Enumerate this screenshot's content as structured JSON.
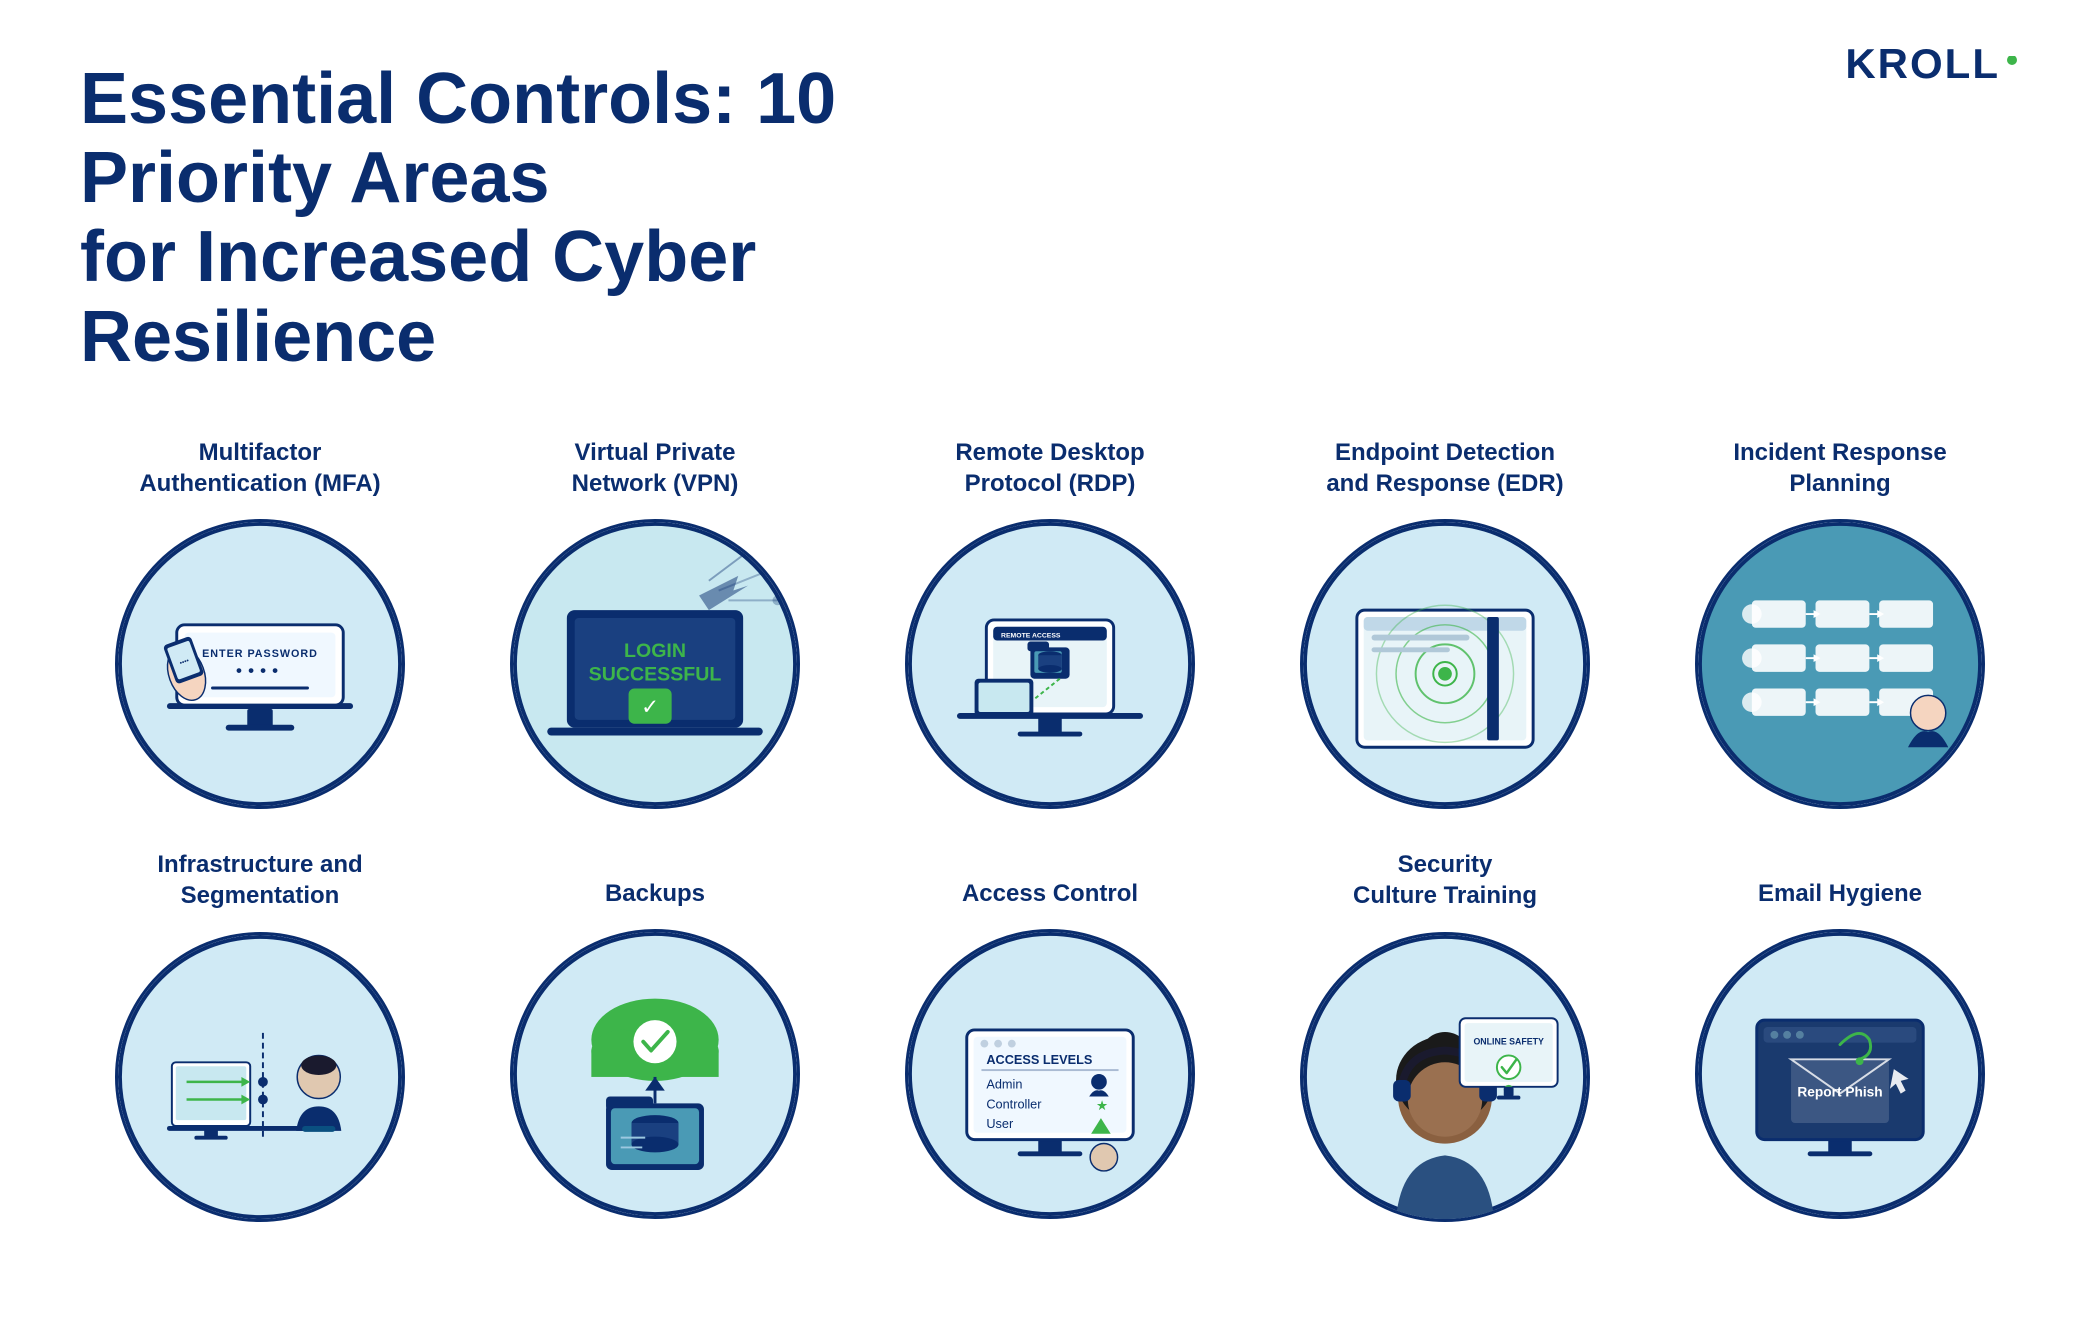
{
  "logo": {
    "text": "KROLL",
    "dot_color": "#3db54a"
  },
  "title": {
    "line1": "Essential Controls: 10 Priority Areas",
    "line2": "for Increased Cyber Resilience"
  },
  "row1": [
    {
      "id": "mfa",
      "title": "Multifactor\nAuthentication (MFA)",
      "title_display": "Multifactor Authentication (MFA)"
    },
    {
      "id": "vpn",
      "title": "Virtual Private\nNetwork (VPN)",
      "title_display": "Virtual Private Network (VPN)"
    },
    {
      "id": "rdp",
      "title": "Remote Desktop\nProtocol (RDP)",
      "title_display": "Remote Desktop Protocol (RDP)"
    },
    {
      "id": "edr",
      "title": "Endpoint Detection\nand Response (EDR)",
      "title_display": "Endpoint Detection and Response (EDR)"
    },
    {
      "id": "irp",
      "title": "Incident Response\nPlanning",
      "title_display": "Incident Response Planning"
    }
  ],
  "row2": [
    {
      "id": "infra",
      "title": "Infrastructure and\nSegmentation",
      "title_display": "Infrastructure and Segmentation"
    },
    {
      "id": "backups",
      "title": "Backups",
      "title_display": "Backups"
    },
    {
      "id": "access",
      "title": "Access Control",
      "title_display": "Access Control",
      "access_levels_label": "ACCESS LEVELS",
      "levels": [
        {
          "name": "Admin",
          "icon": "👤"
        },
        {
          "name": "Controller",
          "icon": "⭐"
        },
        {
          "name": "User",
          "icon": "▲"
        }
      ]
    },
    {
      "id": "security",
      "title": "Security\nCulture Training",
      "title_display": "Security Culture Training",
      "online_safety": "ONLINE SAFETY"
    },
    {
      "id": "email",
      "title": "Email Hygiene",
      "title_display": "Email Hygiene",
      "report_phish": "Report Phish"
    }
  ],
  "colors": {
    "navy": "#0a2d6e",
    "green": "#3db54a",
    "light_blue_bg": "#d0eaf5",
    "teal_bg": "#4a9ab5",
    "white": "#ffffff"
  }
}
